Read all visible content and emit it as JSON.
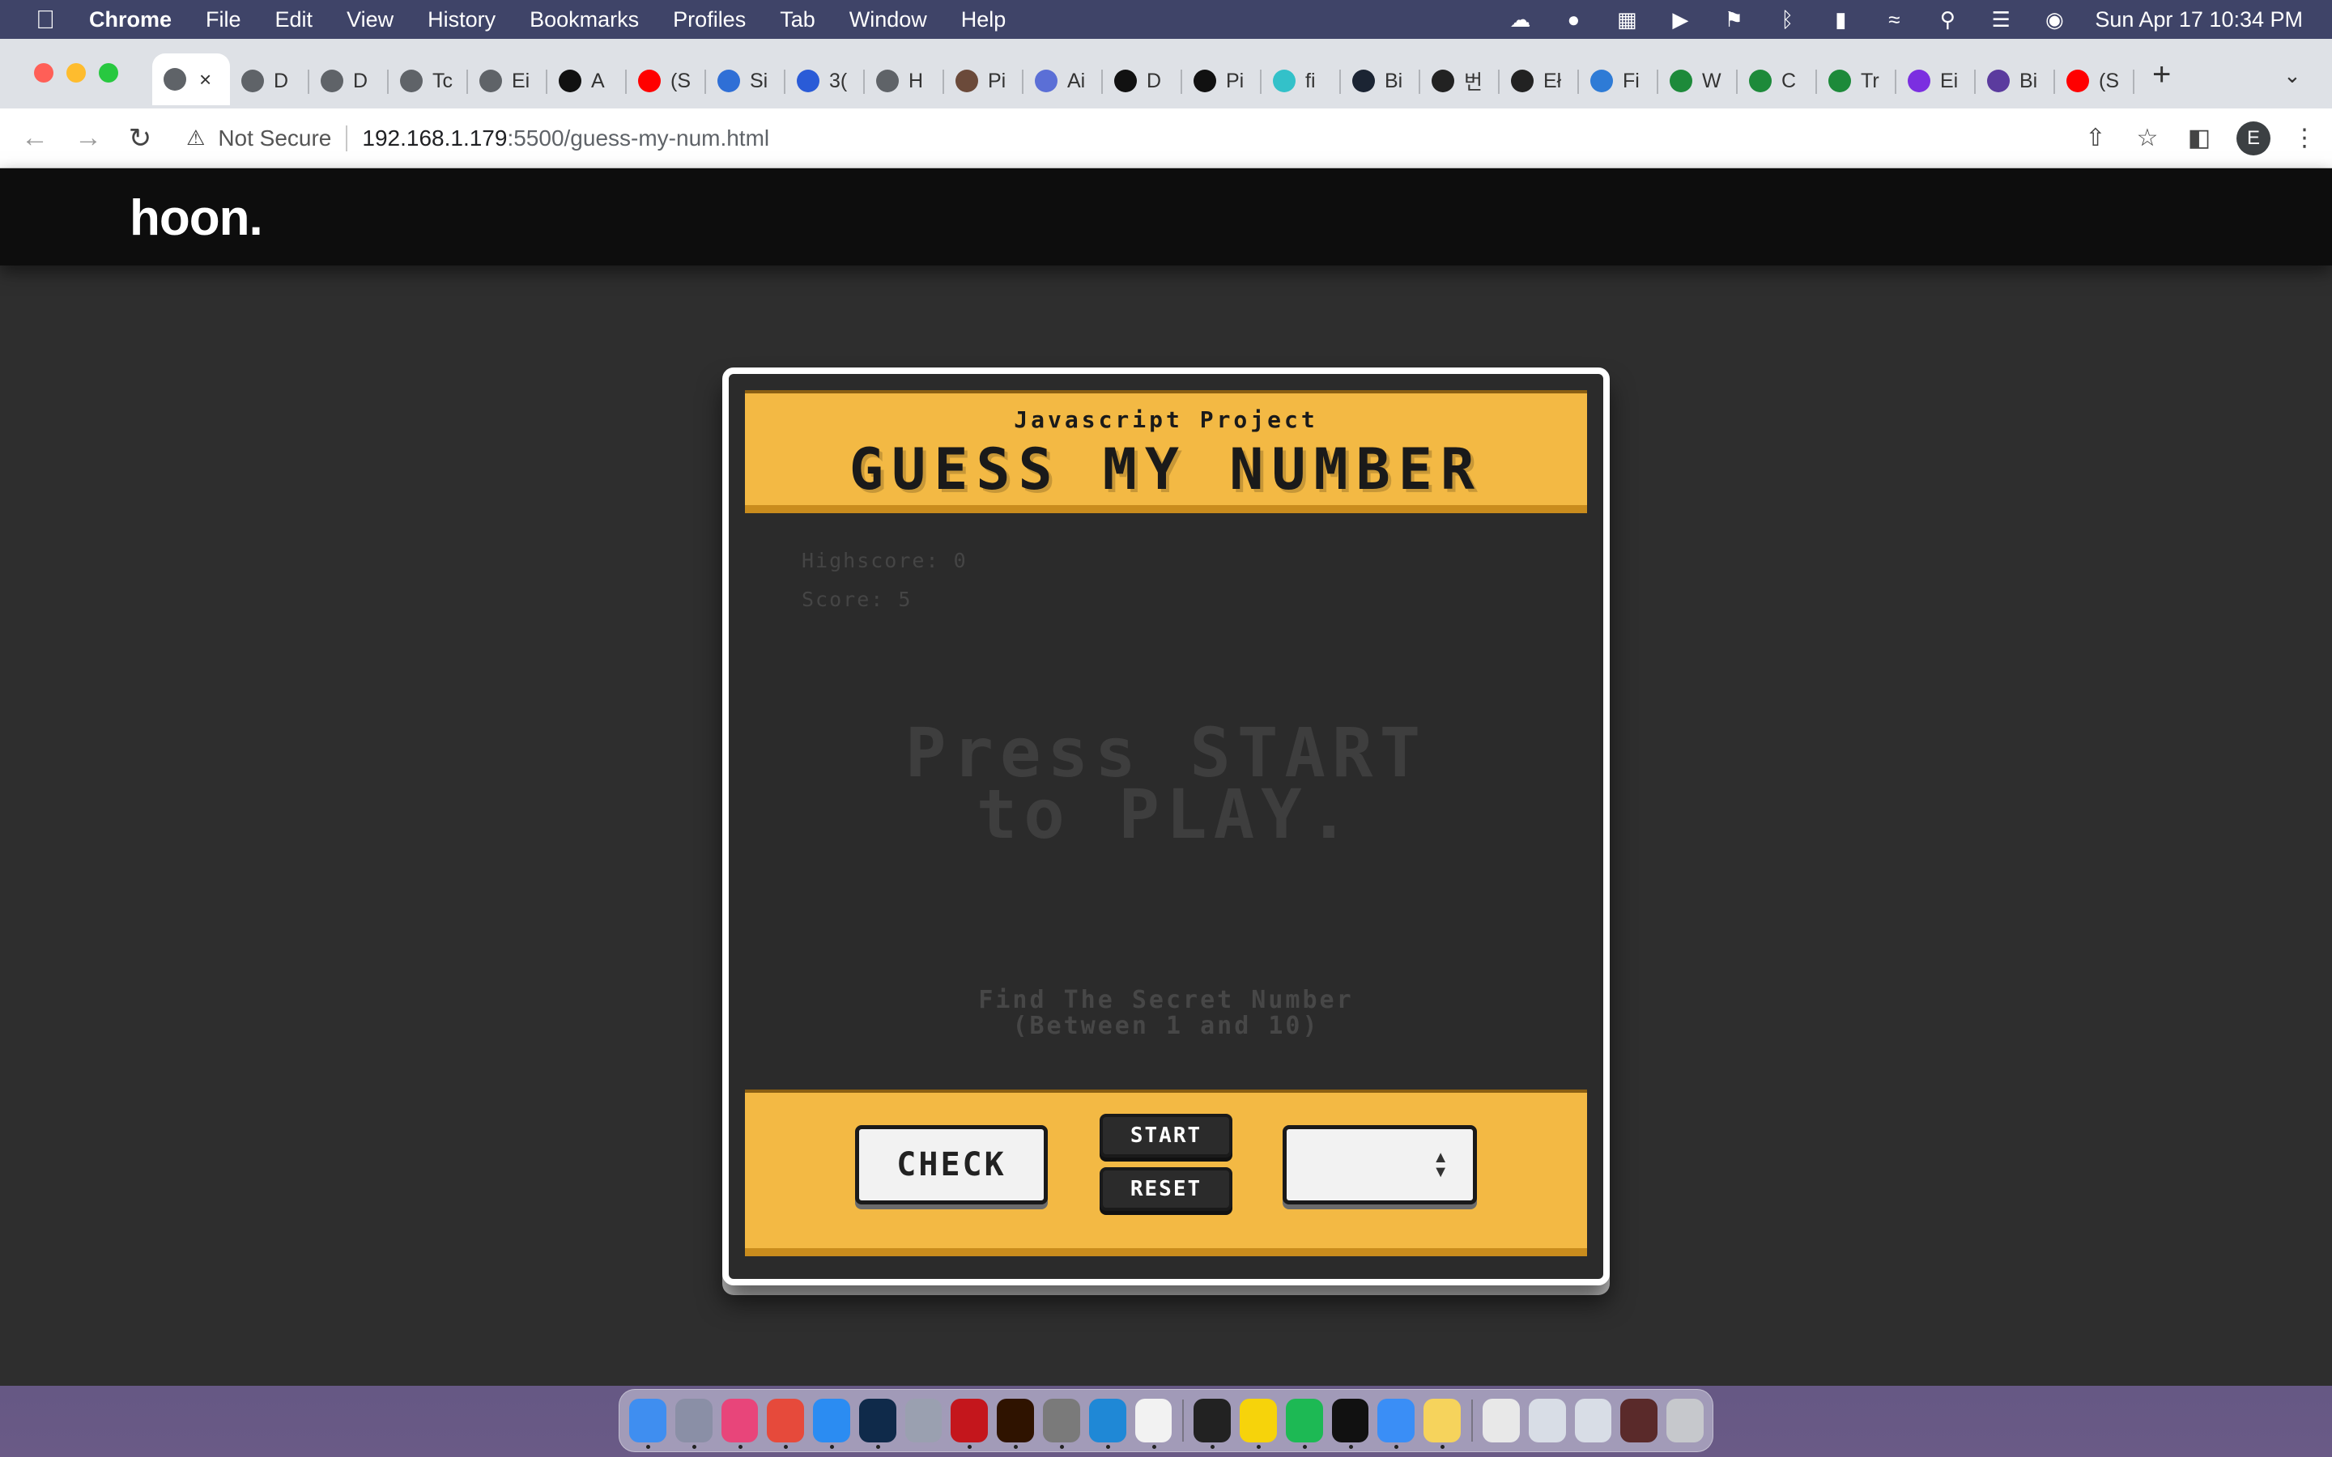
{
  "menubar": {
    "app_name": "Chrome",
    "menus": [
      "File",
      "Edit",
      "View",
      "History",
      "Bookmarks",
      "Profiles",
      "Tab",
      "Window",
      "Help"
    ],
    "clock": "Sun Apr 17  10:34 PM"
  },
  "tabs": [
    {
      "label": "",
      "icon": "globe-icon",
      "color": "#5f6368"
    },
    {
      "label": "D",
      "icon": "globe-icon",
      "color": "#5f6368"
    },
    {
      "label": "D",
      "icon": "globe-icon",
      "color": "#5f6368"
    },
    {
      "label": "Tc",
      "icon": "globe-icon",
      "color": "#5f6368"
    },
    {
      "label": "Ei",
      "icon": "globe-icon",
      "color": "#5f6368"
    },
    {
      "label": "A",
      "icon": "bars-icon",
      "color": "#111111"
    },
    {
      "label": "(S",
      "icon": "youtube-icon",
      "color": "#ff0000"
    },
    {
      "label": "Si",
      "icon": "flag-icon",
      "color": "#2f6fd6"
    },
    {
      "label": "3(",
      "icon": "diamond-icon",
      "color": "#2a5bd7"
    },
    {
      "label": "H",
      "icon": "globe-icon",
      "color": "#5f6368"
    },
    {
      "label": "Pi",
      "icon": "portrait-icon",
      "color": "#6b4a3a"
    },
    {
      "label": "Ai",
      "icon": "triangle-icon",
      "color": "#5b6fd6"
    },
    {
      "label": "D",
      "icon": "adobe-icon",
      "color": "#111111"
    },
    {
      "label": "Pi",
      "icon": "cw-icon",
      "color": "#111111"
    },
    {
      "label": "fi",
      "icon": "hex-icon",
      "color": "#33c1c9"
    },
    {
      "label": "Bi",
      "icon": "b-circle-icon",
      "color": "#1b2433"
    },
    {
      "label": "번",
      "icon": "wix-icon",
      "color": "#222222"
    },
    {
      "label": "Eł",
      "icon": "wix-icon",
      "color": "#222222"
    },
    {
      "label": "Fi",
      "icon": "robot-icon",
      "color": "#2e7bd6"
    },
    {
      "label": "W",
      "icon": "w-icon",
      "color": "#1d8a3a"
    },
    {
      "label": "C",
      "icon": "w-icon",
      "color": "#1d8a3a"
    },
    {
      "label": "Tr",
      "icon": "w-icon",
      "color": "#1d8a3a"
    },
    {
      "label": "Ei",
      "icon": "bootstrap-icon",
      "color": "#7b2fe0"
    },
    {
      "label": "Bi",
      "icon": "bootstrap-icon",
      "color": "#5b3b9e"
    },
    {
      "label": "(S",
      "icon": "youtube-icon",
      "color": "#ff0000"
    }
  ],
  "toolbar": {
    "security_label": "Not Secure",
    "url_host": "192.168.1.179",
    "url_path": ":5500/guess-my-num.html",
    "profile_initial": "E"
  },
  "site": {
    "logo": "hoon."
  },
  "game": {
    "subtitle": "Javascript Project",
    "title": "GUESS MY NUMBER",
    "highscore": "Highscore: 0",
    "score": "Score: 5",
    "prompt_line1": "Press START",
    "prompt_line2": "to PLAY.",
    "hint_line1": "Find The Secret Number",
    "hint_line2": "(Between 1 and 10)",
    "check_label": "CHECK",
    "start_label": "START",
    "reset_label": "RESET",
    "selected_number": ""
  },
  "colors": {
    "accent": "#f3b944",
    "page_bg": "#2e2e2e",
    "header_bg": "#0d0d0d"
  },
  "dock": [
    {
      "name": "finder",
      "color": "#3f8ef0"
    },
    {
      "name": "launchpad",
      "color": "#8a8fa6"
    },
    {
      "name": "creative-cloud",
      "color": "#e8457a"
    },
    {
      "name": "chrome",
      "color": "#e64a3b"
    },
    {
      "name": "app-store",
      "color": "#2b8cf2"
    },
    {
      "name": "lightroom",
      "color": "#0f2a4a"
    },
    {
      "name": "help",
      "color": "#9aa0b0"
    },
    {
      "name": "acrobat",
      "color": "#c4161c"
    },
    {
      "name": "illustrator",
      "color": "#2f1300"
    },
    {
      "name": "system-preferences",
      "color": "#7a7a7a"
    },
    {
      "name": "vscode",
      "color": "#1f88d6"
    },
    {
      "name": "calendar",
      "color": "#f2f2f2"
    },
    {
      "name": "terminal",
      "color": "#222222"
    },
    {
      "name": "kakaotalk",
      "color": "#f6d30b"
    },
    {
      "name": "spotify",
      "color": "#1db954"
    },
    {
      "name": "iterm",
      "color": "#111111"
    },
    {
      "name": "mail",
      "color": "#3a8ef6"
    },
    {
      "name": "notes",
      "color": "#f6d35c"
    },
    {
      "name": "file-1",
      "color": "#e8e8e8"
    },
    {
      "name": "file-2",
      "color": "#d8dde6"
    },
    {
      "name": "file-3",
      "color": "#d8dde6"
    },
    {
      "name": "video",
      "color": "#5a2a2a"
    },
    {
      "name": "trash",
      "color": "#c6c8cc"
    }
  ]
}
